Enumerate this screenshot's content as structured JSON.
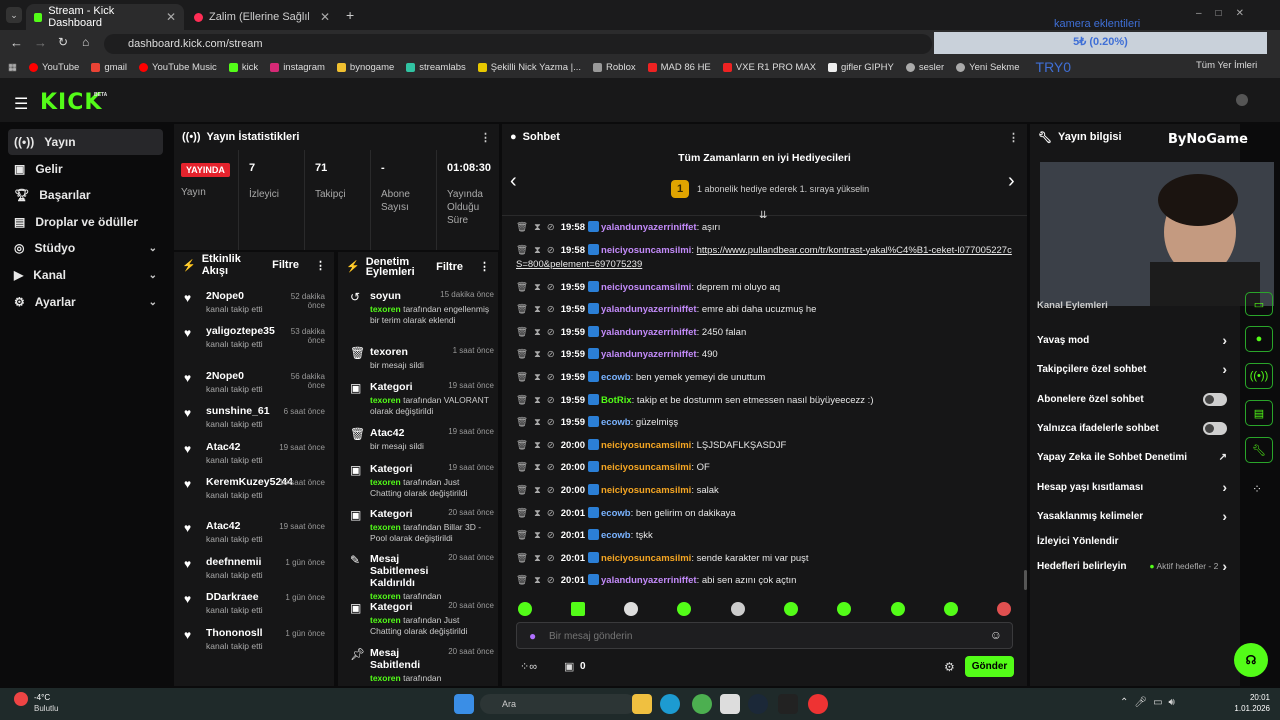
{
  "browser": {
    "tabs": [
      {
        "title": "Stream - Kick Dashboard"
      },
      {
        "title": "Zalim (Ellerine Sağlık) - YouTube"
      }
    ],
    "url": "dashboard.kick.com/stream",
    "bookmarks": [
      "YouTube",
      "gmail",
      "YouTube Music",
      "kick",
      "instagram",
      "bynogame",
      "streamlabs",
      "Şekilli Nick Yazma |...",
      "Roblox",
      "MAD 86 HE",
      "VXE R1 PRO MAX",
      "gifler GIPHY",
      "sesler",
      "Yeni Sekme"
    ],
    "overlay_text": "kamera eklentileri",
    "overlay_value": "5₺ (0.20%)",
    "overlay_tag": "TRY0",
    "overlay_right": "Tüm Yer İmleri"
  },
  "app": {
    "logo": "KICK",
    "logo_sup": "BETA"
  },
  "sidebar": {
    "items": [
      {
        "label": "Yayın"
      },
      {
        "label": "Gelir"
      },
      {
        "label": "Başarılar"
      },
      {
        "label": "Droplar ve ödüller"
      },
      {
        "label": "Stüdyo"
      },
      {
        "label": "Kanal"
      },
      {
        "label": "Ayarlar"
      }
    ]
  },
  "stats": {
    "title": "Yayın İstatistikleri",
    "live_badge": "YAYINDA",
    "live_label": "Yayın",
    "viewers_value": "7",
    "viewers_label": "İzleyici",
    "followers_value": "71",
    "followers_label": "Takipçi",
    "subs_value": "-",
    "subs_label": "Abone Sayısı",
    "uptime_value": "01:08:30",
    "uptime_label": "Yayında Olduğu Süre"
  },
  "activity": {
    "title": "Etkinlik Akışı",
    "filter": "Filtre",
    "items": [
      {
        "name": "2Nope0",
        "sub": "kanalı takip etti",
        "time": "52 dakika önce"
      },
      {
        "name": "yaligoztepe35",
        "sub": "kanalı takip etti",
        "time": "53 dakika önce"
      },
      {
        "name": "2Nope0",
        "sub": "kanalı takip etti",
        "time": "56 dakika önce"
      },
      {
        "name": "sunshine_61",
        "sub": "kanalı takip etti",
        "time": "6 saat önce"
      },
      {
        "name": "Atac42",
        "sub": "kanalı takip etti",
        "time": "19 saat önce"
      },
      {
        "name": "KeremKuzey5244",
        "sub": "kanalı takip etti",
        "time": "19 saat önce"
      },
      {
        "name": "Atac42",
        "sub": "kanalı takip etti",
        "time": "19 saat önce"
      },
      {
        "name": "deefnnemii",
        "sub": "kanalı takip etti",
        "time": "1 gün önce"
      },
      {
        "name": "DDarkraee",
        "sub": "kanalı takip etti",
        "time": "1 gün önce"
      },
      {
        "name": "Thononosll",
        "sub": "kanalı takip etti",
        "time": "1 gün önce"
      }
    ]
  },
  "moderation": {
    "title": "Denetim Eylemleri",
    "filter": "Filtre",
    "items": [
      {
        "name": "soyun",
        "time": "15 dakika önce",
        "actor": "texoren",
        "text": "tarafından engellenmiş bir terim olarak eklendi"
      },
      {
        "name": "texoren",
        "time": "1 saat önce",
        "actor": "",
        "text": "bir mesajı sildi"
      },
      {
        "name": "Kategori",
        "time": "19 saat önce",
        "actor": "texoren",
        "text": "tarafından VALORANT olarak değiştirildi"
      },
      {
        "name": "Atac42",
        "time": "19 saat önce",
        "actor": "",
        "text": "bir mesajı sildi"
      },
      {
        "name": "Kategori",
        "time": "19 saat önce",
        "actor": "texoren",
        "text": "tarafından Just Chatting olarak değiştirildi"
      },
      {
        "name": "Kategori",
        "time": "20 saat önce",
        "actor": "texoren",
        "text": "tarafından Billar 3D - Pool olarak değiştirildi"
      },
      {
        "name": "Mesaj Sabitlemesi Kaldırıldı",
        "time": "20 saat önce",
        "actor": "texoren",
        "text": "tarafından"
      },
      {
        "name": "Kategori",
        "time": "20 saat önce",
        "actor": "texoren",
        "text": "tarafından Just Chatting olarak değiştirildi"
      },
      {
        "name": "Mesaj Sabitlendi",
        "time": "20 saat önce",
        "actor": "texoren",
        "text": "tarafından"
      }
    ]
  },
  "chat": {
    "title": "Sohbet",
    "gifters_title": "Tüm Zamanların en iyi Hediyecileri",
    "gifters_rank": "1",
    "gifters_text": "1 abonelik hediye ederek 1. sıraya yükselin",
    "messages": [
      {
        "time": "19:58",
        "user": "yalandunyazerriniffet",
        "color": "#c38bfa",
        "text": "aşırı"
      },
      {
        "time": "19:58",
        "user": "neiciyosuncamsilmi",
        "color": "#c38bfa",
        "text": "https://www.pullandbear.com/tr/kontrast-yakal%C4%B1-ceket-l077005227cS=800&pelement=697075239"
      },
      {
        "time": "19:59",
        "user": "neiciyosuncamsilmi",
        "color": "#c38bfa",
        "text": "deprem mi oluyo aq"
      },
      {
        "time": "19:59",
        "user": "yalandunyazerriniffet",
        "color": "#c38bfa",
        "text": "emre abi daha ucuzmuş he"
      },
      {
        "time": "19:59",
        "user": "yalandunyazerriniffet",
        "color": "#c38bfa",
        "text": "2450 falan"
      },
      {
        "time": "19:59",
        "user": "yalandunyazerriniffet",
        "color": "#c38bfa",
        "text": "490"
      },
      {
        "time": "19:59",
        "user": "ecowb",
        "color": "#7ab3ff",
        "text": "ben yemek yemeyi de unuttum"
      },
      {
        "time": "19:59",
        "user": "BotRix",
        "color": "#53fc18",
        "text": "takip et be dostumm sen etmessen nasıl büyüyeecezz :)"
      },
      {
        "time": "19:59",
        "user": "ecowb",
        "color": "#7ab3ff",
        "text": "güzelmişş"
      },
      {
        "time": "20:00",
        "user": "neiciyosuncamsilmi",
        "color": "#f5a623",
        "text": "LŞJSDAFLKŞASDJF"
      },
      {
        "time": "20:00",
        "user": "neiciyosuncamsilmi",
        "color": "#f5a623",
        "text": "OF"
      },
      {
        "time": "20:00",
        "user": "neiciyosuncamsilmi",
        "color": "#f5a623",
        "text": "salak"
      },
      {
        "time": "20:01",
        "user": "ecowb",
        "color": "#7ab3ff",
        "text": "ben gelirim on dakikaya"
      },
      {
        "time": "20:01",
        "user": "ecowb",
        "color": "#7ab3ff",
        "text": "tşkk"
      },
      {
        "time": "20:01",
        "user": "neiciyosuncamsilmi",
        "color": "#f5a623",
        "text": "sende karakter mi var puşt"
      },
      {
        "time": "20:01",
        "user": "yalandunyazerriniffet",
        "color": "#c38bfa",
        "text": "abi sen azını çok açtın"
      }
    ],
    "input_placeholder": "Bir mesaj gönderin",
    "points": "0",
    "send": "Gönder"
  },
  "stream_info": {
    "title": "Yayın bilgisi",
    "brand": "ByNoGame",
    "channel_actions": "Kanal Eylemleri",
    "rows": [
      {
        "label": "Yavaş mod",
        "kind": "arrow"
      },
      {
        "label": "Takipçilere özel sohbet",
        "kind": "arrow"
      },
      {
        "label": "Abonelere özel sohbet",
        "kind": "toggle"
      },
      {
        "label": "Yalnızca ifadelerle sohbet",
        "kind": "toggle"
      },
      {
        "label": "Yapay Zeka ile Sohbet Denetimi",
        "kind": "external"
      },
      {
        "label": "Hesap yaşı kısıtlaması",
        "kind": "arrow"
      },
      {
        "label": "Yasaklanmış kelimeler",
        "kind": "arrow"
      },
      {
        "label": "İzleyici Yönlendir",
        "kind": "none"
      },
      {
        "label": "Hedefleri belirleyin",
        "kind": "arrow"
      }
    ],
    "goals_status": "Aktif hedefler - 2"
  },
  "taskbar": {
    "weather_temp": "-4°C",
    "weather_text": "Bulutlu",
    "search": "Ara",
    "time": "20:01",
    "date": "1.01.2026"
  }
}
